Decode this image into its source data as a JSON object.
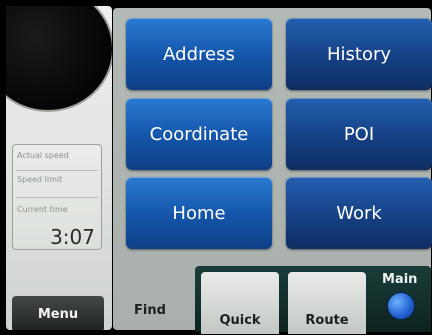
{
  "sidebar": {
    "info": {
      "actual_speed_label": "Actual speed",
      "speed_limit_label": "Speed limit",
      "current_time_label": "Current time",
      "current_time_value": "3:07"
    },
    "menu_label": "Menu"
  },
  "grid": {
    "buttons": [
      {
        "label": "Address"
      },
      {
        "label": "History"
      },
      {
        "label": "Coordinate"
      },
      {
        "label": "POI"
      },
      {
        "label": "Home"
      },
      {
        "label": "Work"
      }
    ]
  },
  "tabs": {
    "find_label": "Find",
    "quick_label": "Quick",
    "route_label": "Route",
    "main_label": "Main"
  },
  "colors": {
    "button_blue": "#1454a8",
    "panel_gray": "#b3bab6"
  }
}
